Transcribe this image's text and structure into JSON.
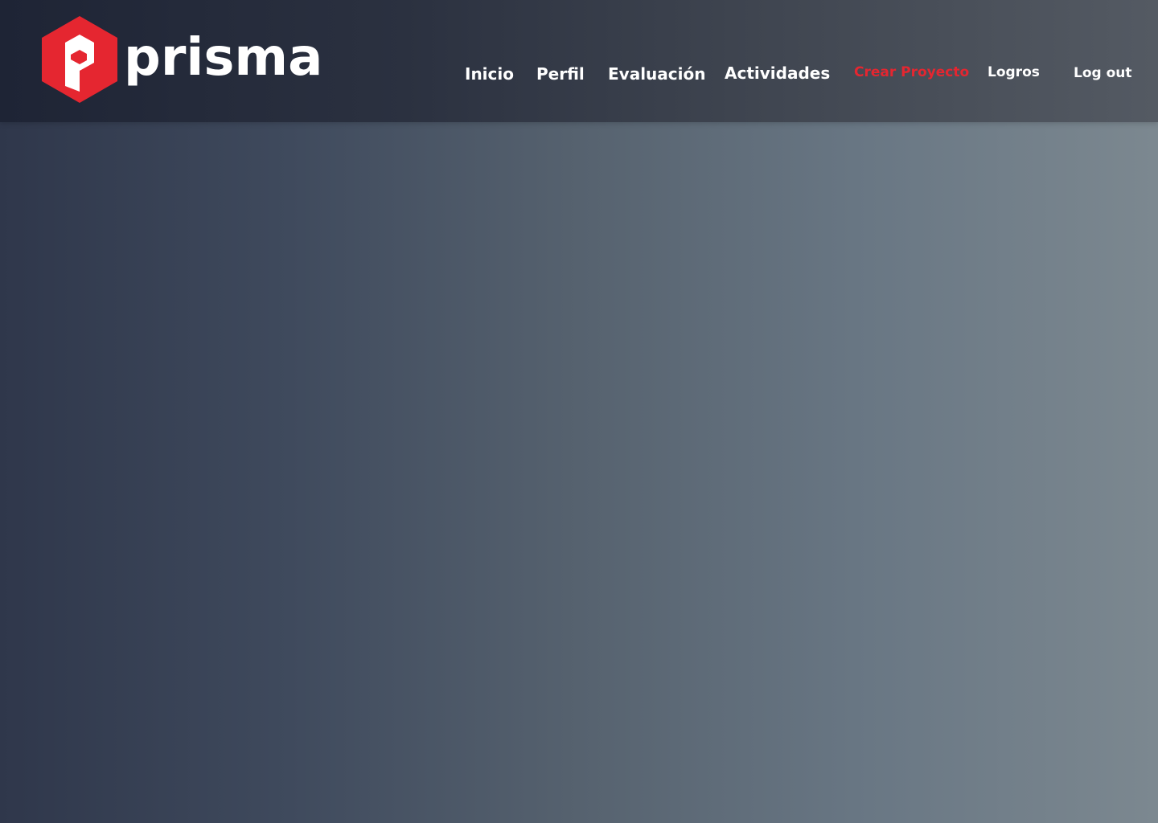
{
  "brand": {
    "name": "prisma",
    "logo_icon": "hexagon-p-icon",
    "logo_color": "#e52630",
    "text_color": "#ffffff"
  },
  "nav": {
    "items": [
      {
        "label": "Inicio",
        "active": false
      },
      {
        "label": "Perfil",
        "active": false
      },
      {
        "label": "Evaluación",
        "active": false
      },
      {
        "label": "Actividades",
        "active": false
      },
      {
        "label": "Crear Proyecto",
        "active": true
      },
      {
        "label": "Logros",
        "active": false
      },
      {
        "label": "Log out",
        "active": false
      }
    ],
    "active_color": "#e52630"
  },
  "colors": {
    "header_start": "#1e2435",
    "header_end": "#545a63",
    "body_start": "#2f374b",
    "body_end": "#7c8890"
  }
}
